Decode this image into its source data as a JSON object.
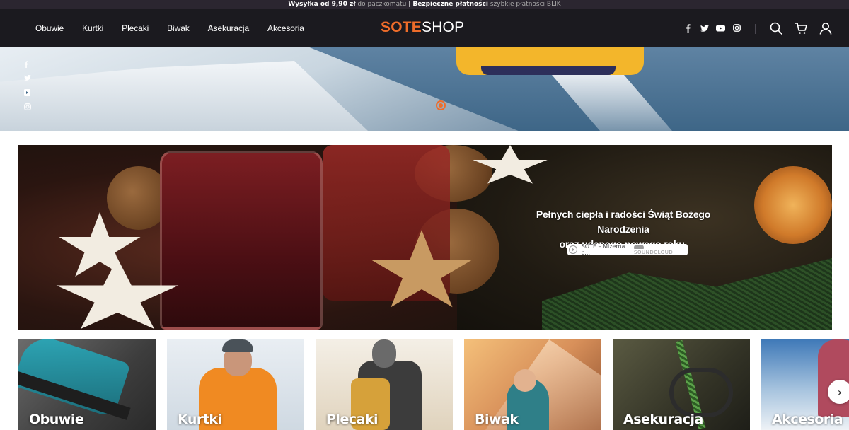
{
  "topbar": {
    "shipping_bold": "Wysyłka od 9,90 zł",
    "shipping_rest": "do paczkomatu",
    "sep": "|",
    "payments_bold": "Bezpieczne płatności",
    "payments_rest": "szybkie płatności BLIK"
  },
  "nav": {
    "items": [
      "Obuwie",
      "Kurtki",
      "Plecaki",
      "Biwak",
      "Asekuracja",
      "Akcesoria"
    ]
  },
  "logo": {
    "part1": "SOTE",
    "part2": "SHOP"
  },
  "social": [
    "facebook-icon",
    "twitter-icon",
    "youtube-icon",
    "instagram-icon"
  ],
  "actions": [
    "search-icon",
    "cart-icon",
    "user-icon"
  ],
  "hero": {
    "slider_dot_active": true
  },
  "banner": {
    "line1": "Pełnych ciepła i radości Świąt Bożego Narodzenia",
    "line2": "oraz udanego nowego roku.",
    "player_title": "SOTE – Mizerna c…",
    "player_brand": "SOUNDCLOUD"
  },
  "categories": [
    "Obuwie",
    "Kurtki",
    "Plecaki",
    "Biwak",
    "Asekuracja",
    "Akcesoria"
  ],
  "next_arrow": "›",
  "colors": {
    "accent": "#ee6c2a",
    "header_bg": "#1b1a1f",
    "topbar_bg": "#2b2630"
  }
}
